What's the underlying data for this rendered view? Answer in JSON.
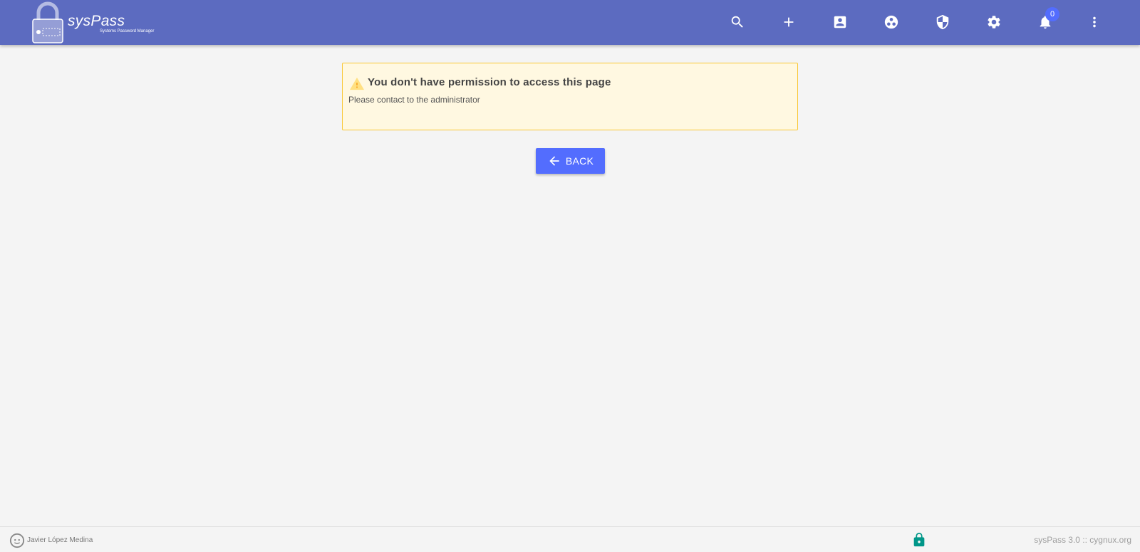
{
  "app": {
    "brand": "sysPass",
    "tagline": "Systems Password Manager"
  },
  "topbar": {
    "icons": [
      "search-icon",
      "add-icon",
      "contact-icon",
      "groups-icon",
      "security-icon",
      "settings-icon",
      "notifications-icon",
      "more-icon"
    ],
    "notification_count": "0"
  },
  "alert": {
    "title": "You don't have permission to access this page",
    "message": "Please contact to the administrator"
  },
  "back_button": {
    "label": "BACK"
  },
  "footer": {
    "author": "Javier López Medina",
    "version": "sysPass 3.0  ::  cygnux.org"
  },
  "colors": {
    "topbar": "#5c6bc0",
    "accent": "#536dfe",
    "alert_bg": "#fff8e1",
    "alert_border": "#f9c735",
    "lock_green": "#009688"
  }
}
